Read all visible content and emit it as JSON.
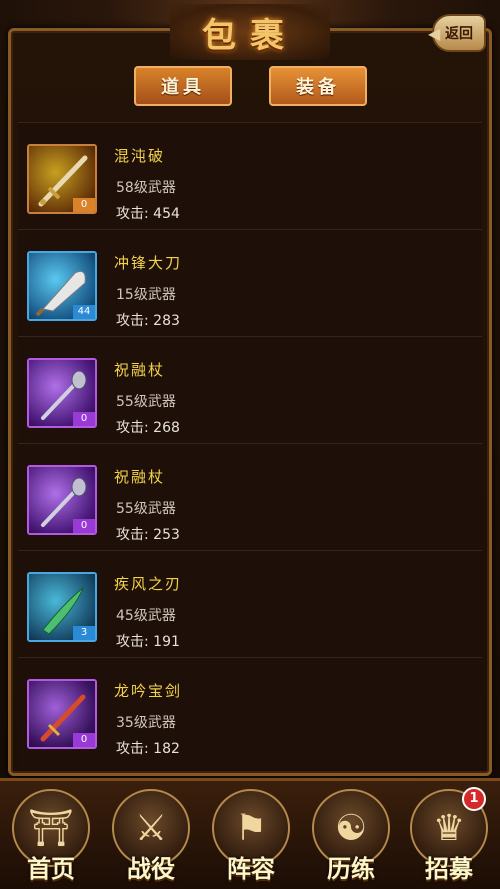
{
  "header": {
    "title": "包裹",
    "back_label": "返回"
  },
  "tabs": [
    {
      "label": "道具",
      "active": false
    },
    {
      "label": "装备",
      "active": true
    }
  ],
  "items": [
    {
      "name": "混沌破",
      "level": "58级武器",
      "attack": "攻击: 454",
      "count": "0",
      "rarity": "orange",
      "icon": "sword-icon"
    },
    {
      "name": "冲锋大刀",
      "level": "15级武器",
      "attack": "攻击: 283",
      "count": "44",
      "rarity": "blue",
      "icon": "broadsword-icon"
    },
    {
      "name": "祝融杖",
      "level": "55级武器",
      "attack": "攻击: 268",
      "count": "0",
      "rarity": "purple",
      "icon": "staff-icon"
    },
    {
      "name": "祝融杖",
      "level": "55级武器",
      "attack": "攻击: 253",
      "count": "0",
      "rarity": "purple",
      "icon": "staff-icon"
    },
    {
      "name": "疾风之刃",
      "level": "45级武器",
      "attack": "攻击: 191",
      "count": "3",
      "rarity": "blue",
      "icon": "blade-icon"
    },
    {
      "name": "龙吟宝剑",
      "level": "35级武器",
      "attack": "攻击: 182",
      "count": "0",
      "rarity": "purple",
      "icon": "dragon-sword-icon"
    }
  ],
  "bottom_nav": [
    {
      "label": "首页",
      "icon": "palace-icon"
    },
    {
      "label": "战役",
      "icon": "crossed-swords-icon"
    },
    {
      "label": "阵容",
      "icon": "formation-icon"
    },
    {
      "label": "历练",
      "icon": "yin-yang-icon"
    },
    {
      "label": "招募",
      "icon": "recruit-icon",
      "badge": "1"
    }
  ],
  "colors": {
    "orange": "#d9822a",
    "blue": "#2a8ad6",
    "purple": "#9a3ad6",
    "name_text": "#f3d34a"
  }
}
